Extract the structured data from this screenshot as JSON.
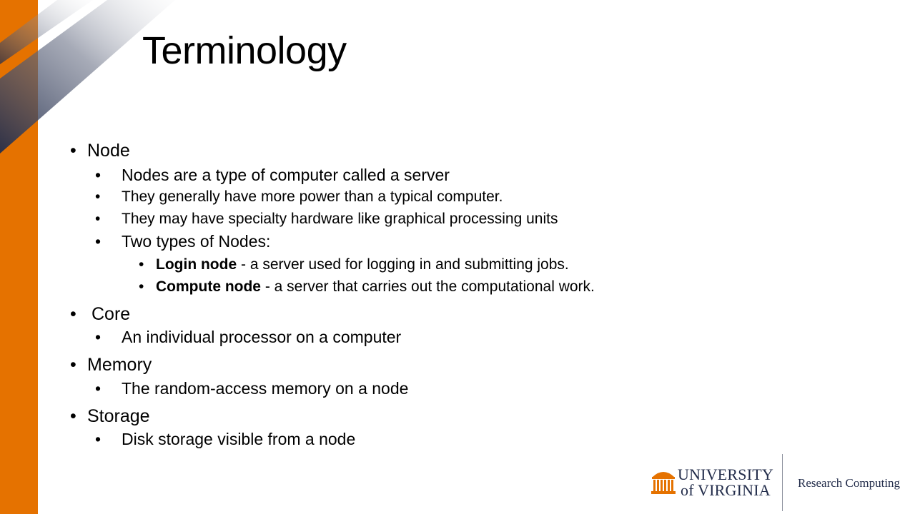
{
  "slide": {
    "title": "Terminology",
    "colors": {
      "accent_orange": "#E57200",
      "navy": "#232D4B",
      "text": "#000000",
      "divider": "#8a8f9c"
    }
  },
  "bullets": {
    "node": {
      "label": "Node",
      "items": [
        "Nodes are a type of computer called a server",
        "They generally have more power than a typical computer.",
        "They may have specialty hardware like graphical processing units",
        "Two types of Nodes:"
      ],
      "types": [
        {
          "term": "Login node",
          "desc": " - a server used for logging in and submitting jobs."
        },
        {
          "term": "Compute node",
          "desc": " - a server that carries out the computational work."
        }
      ]
    },
    "core": {
      "label": "Core",
      "items": [
        "An individual processor on a computer"
      ]
    },
    "memory": {
      "label": "Memory",
      "items": [
        "The random-access memory on a node"
      ]
    },
    "storage": {
      "label": "Storage",
      "items": [
        "Disk storage visible from a node"
      ]
    }
  },
  "footer": {
    "university_line1": "UNIVERSITY",
    "university_line2": "of VIRGINIA",
    "department": "Research Computing",
    "logo_icon": "rotunda-icon"
  }
}
